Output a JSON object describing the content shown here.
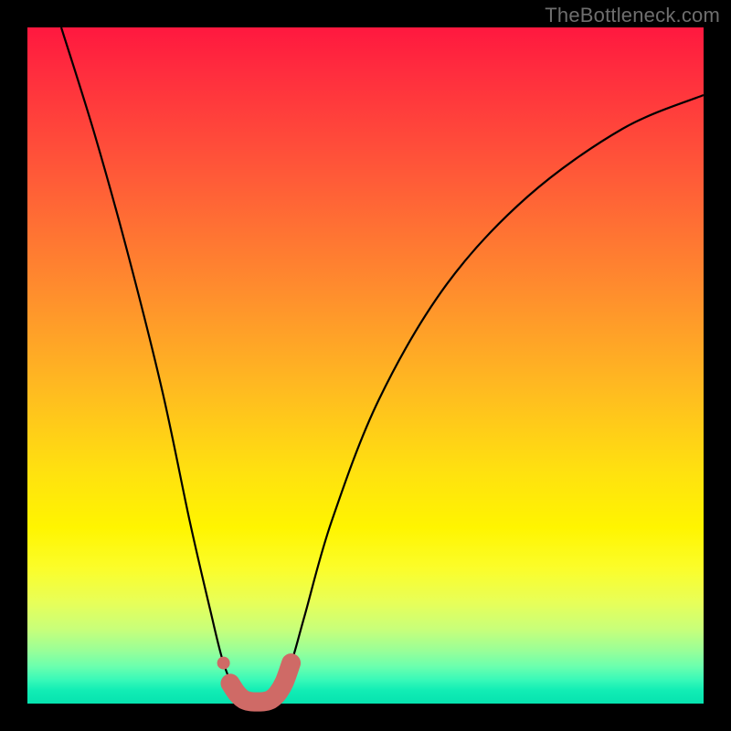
{
  "watermark": "TheBottleneck.com",
  "colors": {
    "marker": "#cf6a66",
    "curve": "#000000",
    "frame": "#000000"
  },
  "chart_data": {
    "type": "line",
    "title": "",
    "xlabel": "",
    "ylabel": "",
    "xlim": [
      0,
      100
    ],
    "ylim": [
      0,
      100
    ],
    "series": [
      {
        "name": "bottleneck-curve",
        "x": [
          5,
          10,
          15,
          20,
          24,
          27,
          29,
          31,
          33,
          35,
          37,
          39,
          41,
          45,
          52,
          62,
          74,
          88,
          100
        ],
        "y": [
          100,
          84,
          66,
          46,
          27,
          14,
          6,
          1.5,
          0.3,
          0.3,
          1.5,
          6,
          13,
          27,
          45,
          62,
          75,
          85,
          90
        ]
      }
    ],
    "markers": {
      "name": "highlight-band",
      "color": "#cf6a66",
      "x": [
        29.0,
        30.0,
        31.0,
        32.0,
        33.0,
        34.0,
        35.0,
        36.0,
        37.0,
        38.0,
        39.0
      ],
      "y": [
        6.0,
        3.0,
        1.5,
        0.6,
        0.3,
        0.25,
        0.3,
        0.6,
        1.5,
        3.2,
        6.0
      ]
    }
  }
}
